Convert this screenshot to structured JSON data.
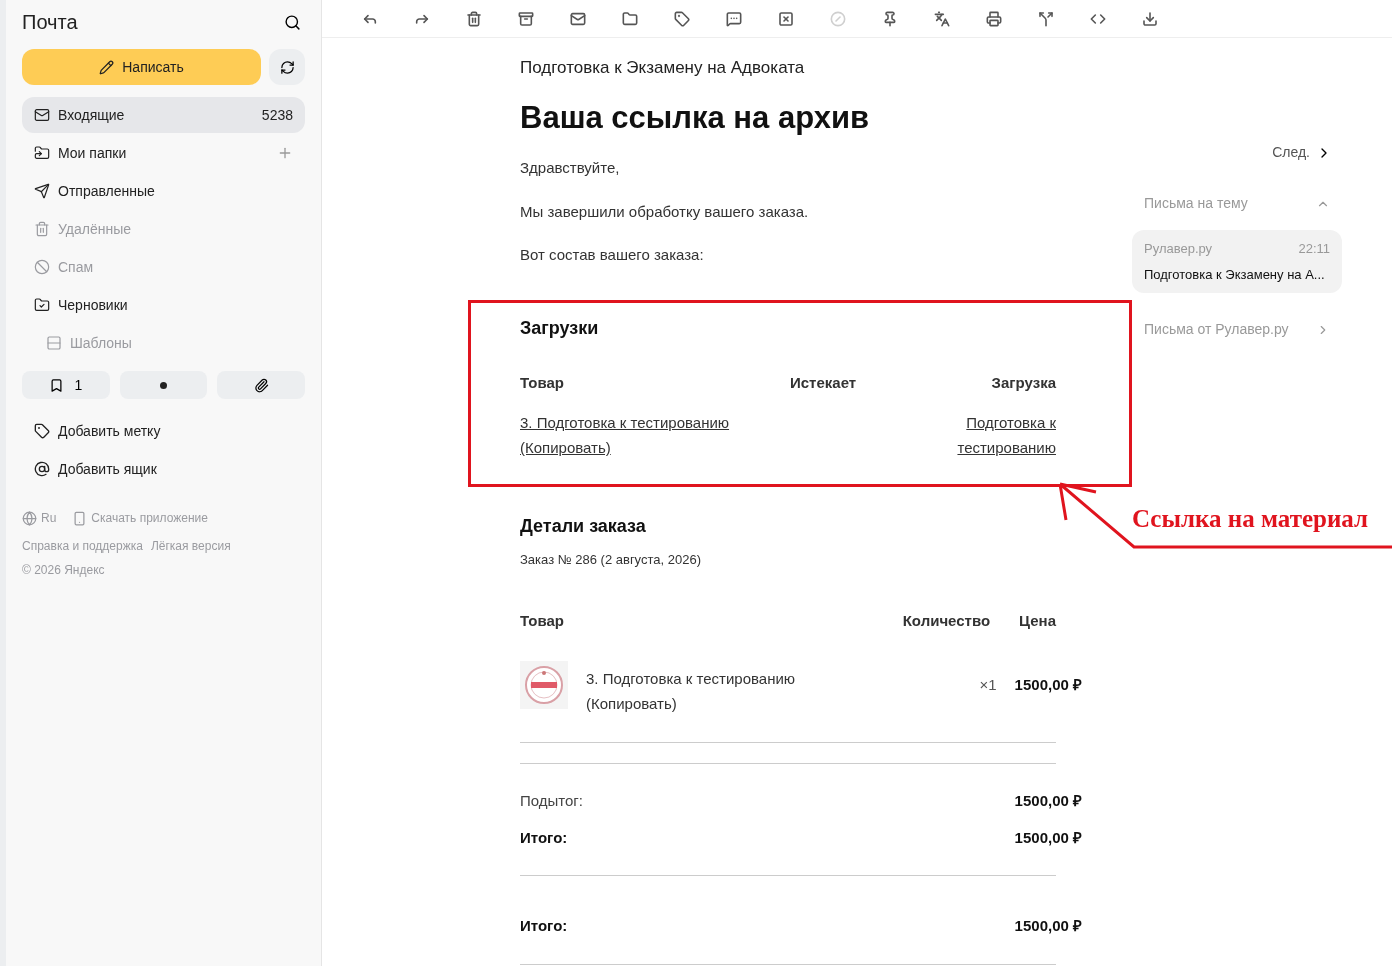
{
  "sidebar": {
    "title": "Почта",
    "compose": "Написать",
    "folders": [
      {
        "label": "Входящие",
        "count": "5238",
        "selected": true,
        "dimmed": false
      },
      {
        "label": "Мои папки",
        "selected": false,
        "dimmed": false
      },
      {
        "label": "Отправленные",
        "selected": false,
        "dimmed": false
      },
      {
        "label": "Удалённые",
        "selected": false,
        "dimmed": true
      },
      {
        "label": "Спам",
        "selected": false,
        "dimmed": true
      },
      {
        "label": "Черновики",
        "selected": false,
        "dimmed": false,
        "children": [
          {
            "label": "Шаблоны",
            "selected": false,
            "dimmed": true
          }
        ]
      }
    ],
    "filter_count": "1",
    "actions": [
      "Добавить метку",
      "Добавить ящик"
    ],
    "footer": {
      "language": "Ru",
      "app": "Скачать приложение",
      "links": [
        "Справка и поддержка",
        "Лёгкая версия"
      ],
      "copyright": "© 2026 Яндекс"
    }
  },
  "toolbar": [
    {
      "disabled": false
    },
    {
      "disabled": false
    },
    {
      "disabled": false
    },
    {
      "disabled": false
    },
    {
      "disabled": false
    },
    {
      "disabled": false
    },
    {
      "disabled": false
    },
    {
      "disabled": false
    },
    {
      "disabled": false
    },
    {
      "disabled": true
    },
    {
      "disabled": false
    },
    {
      "disabled": false
    },
    {
      "disabled": false
    },
    {
      "disabled": false
    },
    {
      "disabled": false
    },
    {
      "disabled": false
    }
  ],
  "email": {
    "sender_line": "Подготовка к Экзамену на Адвоката",
    "title": "Ваша ссылка на архив",
    "paragraphs": [
      "Здравствуйте,",
      "Мы завершили обработку вашего заказа.",
      "Вот состав вашего заказа:"
    ],
    "downloads": {
      "title": "Загрузки",
      "columns": [
        "Товар",
        "Истекает",
        "Загрузка"
      ],
      "rows": [
        {
          "product": "3. Подготовка к тестированию (Копировать)",
          "download": "Подготовка к тестированию"
        }
      ]
    },
    "order": {
      "title": "Детали заказа",
      "subtitle": "Заказ № 286 (2 августа, 2026)",
      "columns": [
        "Товар",
        "Количество",
        "Цена"
      ],
      "items": [
        {
          "name": "3. Подготовка к тестированию (Копировать)",
          "qty": "×1",
          "price": "1500,00 ₽"
        }
      ],
      "totals": [
        {
          "label": "Подытог:",
          "value": "1500,00 ₽",
          "bold": false
        },
        {
          "label": "Итого:",
          "value": "1500,00 ₽",
          "bold": true
        }
      ],
      "grand_total": {
        "label": "Итого:",
        "value": "1500,00 ₽"
      }
    }
  },
  "thread": {
    "next": "След.",
    "topic": "Письма на тему",
    "expanded": true,
    "messages": [
      {
        "sender": "Рулавер.ру",
        "time": "22:11",
        "subject": "Подготовка к Экзамену на А...",
        "selected": true
      }
    ],
    "from_sender": "Письма от Рулавер.ру"
  },
  "annotation": "Ссылка на материал"
}
